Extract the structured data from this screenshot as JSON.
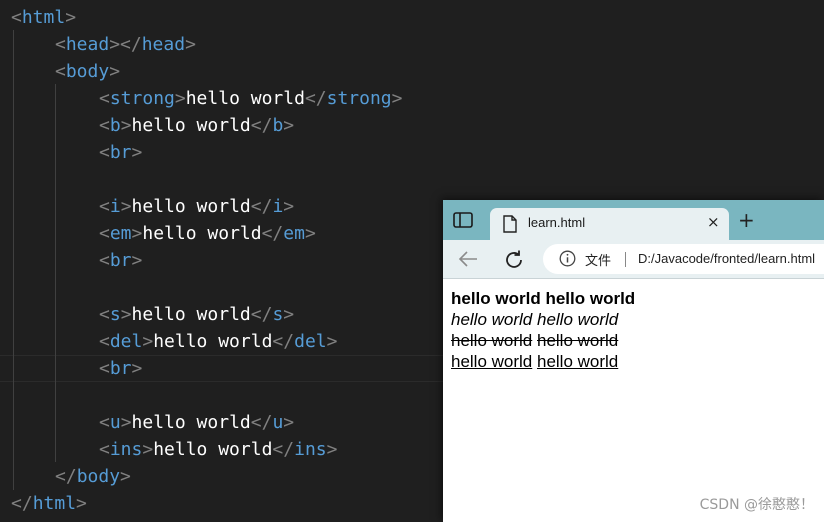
{
  "editor": {
    "lines": [
      {
        "a": "<",
        "t": "html",
        "b": ">"
      },
      {
        "a": "<",
        "t": "head",
        "b": "></",
        "t2": "head",
        "c": ">"
      },
      {
        "a": "<",
        "t": "body",
        "b": ">"
      },
      {
        "a": "<",
        "t": "strong",
        "b": ">",
        "x": "hello world",
        "c": "</",
        "t2": "strong",
        "d": ">"
      },
      {
        "a": "<",
        "t": "b",
        "b": ">",
        "x": "hello world",
        "c": "</",
        "t2": "b",
        "d": ">"
      },
      {
        "a": "<",
        "t": "br",
        "b": ">"
      },
      {
        "a": "<",
        "t": "i",
        "b": ">",
        "x": "hello world",
        "c": "</",
        "t2": "i",
        "d": ">"
      },
      {
        "a": "<",
        "t": "em",
        "b": ">",
        "x": "hello world",
        "c": "</",
        "t2": "em",
        "d": ">"
      },
      {
        "a": "<",
        "t": "br",
        "b": ">"
      },
      {
        "a": "<",
        "t": "s",
        "b": ">",
        "x": "hello world",
        "c": "</",
        "t2": "s",
        "d": ">"
      },
      {
        "a": "<",
        "t": "del",
        "b": ">",
        "x": "hello world",
        "c": "</",
        "t2": "del",
        "d": ">"
      },
      {
        "a": "<",
        "t": "br",
        "b": ">"
      },
      {
        "a": "<",
        "t": "u",
        "b": ">",
        "x": "hello world",
        "c": "</",
        "t2": "u",
        "d": ">"
      },
      {
        "a": "<",
        "t": "ins",
        "b": ">",
        "x": "hello world",
        "c": "</",
        "t2": "ins",
        "d": ">"
      },
      {
        "a": "</",
        "t": "body",
        "b": ">"
      },
      {
        "a": "</",
        "t": "html",
        "b": ">"
      }
    ]
  },
  "browser": {
    "tab_title": "learn.html",
    "tab_close": "×",
    "new_tab": "+",
    "file_label": "文件",
    "url": "D:/Javacode/fronted/learn.html"
  },
  "page": {
    "bold1": "hello world",
    "bold2": "hello world",
    "italic1": "hello world",
    "italic2": "hello world",
    "strike1": "hello world",
    "strike2": "hello world",
    "under1": "hello world",
    "under2": "hello world"
  },
  "watermark": "CSDN @徐憨憨！",
  "colors": {
    "tag": "#569cd6",
    "bracket": "#808080",
    "text": "#ffffff",
    "tabbar": "#7ab6c0"
  }
}
